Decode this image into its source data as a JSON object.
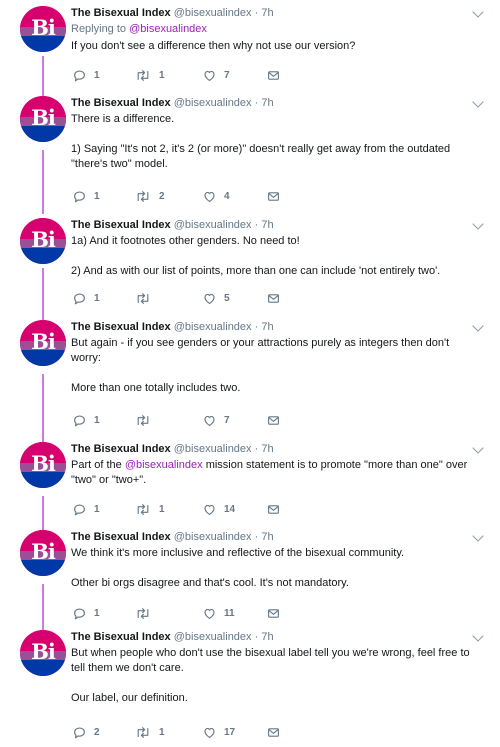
{
  "author": {
    "name": "The Bisexual Index",
    "handle": "@bisexualindex",
    "time": "7h",
    "avatar_text": "Bi"
  },
  "colors": {
    "thread_line": "#cc7be6",
    "link": "#9b1fb5",
    "avatar_pink": "#d6006f",
    "avatar_purple": "#9b4f96",
    "avatar_blue": "#0038a8"
  },
  "tweets": [
    {
      "reply_prefix": "Replying to ",
      "reply_handle": "@bisexualindex",
      "paragraphs": [
        "If you don't see a difference then why not use our version?"
      ],
      "counts": {
        "reply": "1",
        "retweet": "1",
        "like": "7"
      }
    },
    {
      "paragraphs": [
        "There is a difference.",
        "1) Saying \"It's not 2, it's 2 (or more)\" doesn't really get away from the outdated \"there's two\" model."
      ],
      "counts": {
        "reply": "1",
        "retweet": "2",
        "like": "4"
      }
    },
    {
      "paragraphs": [
        "1a) And it footnotes other genders. No need to!",
        "2) And as with our list of points, more than one can include 'not entirely two'."
      ],
      "counts": {
        "reply": "1",
        "retweet": "",
        "like": "5"
      }
    },
    {
      "paragraphs": [
        "But again - if you see genders or your attractions purely as integers then don't worry:",
        "More than one totally includes two."
      ],
      "counts": {
        "reply": "1",
        "retweet": "",
        "like": "7"
      }
    },
    {
      "text_pre": "Part of the ",
      "text_mention": "@bisexualindex",
      "text_post": " mission statement is to promote \"more than one\" over \"two\" or \"two+\".",
      "counts": {
        "reply": "1",
        "retweet": "1",
        "like": "14"
      }
    },
    {
      "paragraphs": [
        "We think it's more inclusive and reflective of the bisexual community.",
        "Other bi orgs disagree and that's cool. It's not mandatory."
      ],
      "counts": {
        "reply": "1",
        "retweet": "",
        "like": "11"
      }
    },
    {
      "paragraphs": [
        "But when people who don't use the bisexual label tell you we're wrong, feel free to tell them we don't care.",
        "Our label, our definition."
      ],
      "counts": {
        "reply": "2",
        "retweet": "1",
        "like": "17"
      }
    }
  ],
  "icons": [
    "reply-icon",
    "retweet-icon",
    "like-icon",
    "message-icon",
    "chevron-down-icon"
  ]
}
